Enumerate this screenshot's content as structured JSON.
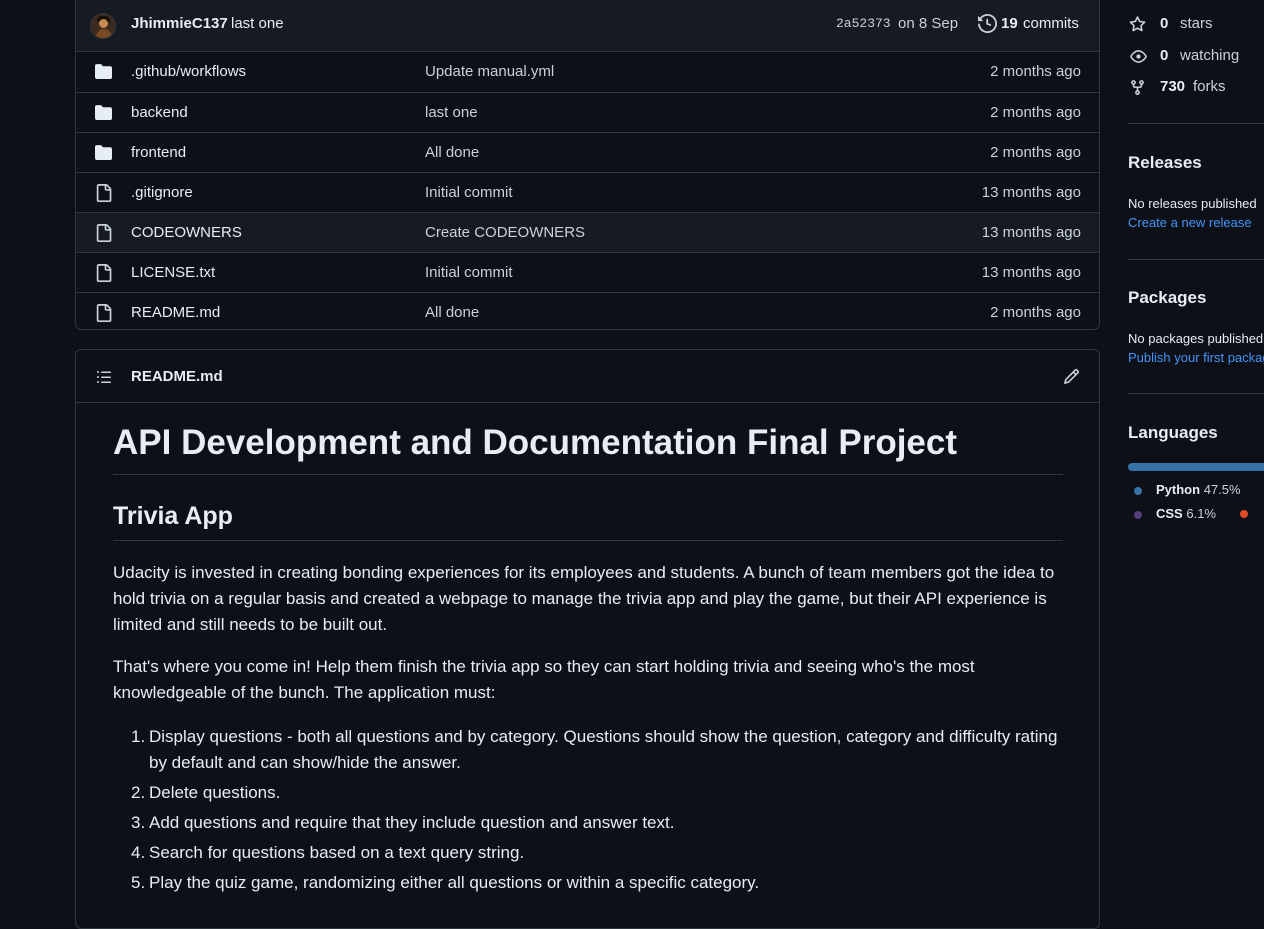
{
  "commit": {
    "author": "JhimmieC137",
    "message": "last one",
    "hash": "2a52373",
    "date": "on 8 Sep",
    "count": "19",
    "count_label": "commits"
  },
  "files": [
    {
      "type": "folder",
      "name": ".github/workflows",
      "message": "Update manual.yml",
      "age": "2 months ago"
    },
    {
      "type": "folder",
      "name": "backend",
      "message": "last one",
      "age": "2 months ago"
    },
    {
      "type": "folder",
      "name": "frontend",
      "message": "All done",
      "age": "2 months ago"
    },
    {
      "type": "file",
      "name": ".gitignore",
      "message": "Initial commit",
      "age": "13 months ago"
    },
    {
      "type": "file",
      "name": "CODEOWNERS",
      "message": "Create CODEOWNERS",
      "age": "13 months ago"
    },
    {
      "type": "file",
      "name": "LICENSE.txt",
      "message": "Initial commit",
      "age": "13 months ago"
    },
    {
      "type": "file",
      "name": "README.md",
      "message": "All done",
      "age": "2 months ago"
    }
  ],
  "readme": {
    "filename": "README.md",
    "h1": "API Development and Documentation Final Project",
    "h2": "Trivia App",
    "p1": "Udacity is invested in creating bonding experiences for its employees and students. A bunch of team members got the idea to hold trivia on a regular basis and created a webpage to manage the trivia app and play the game, but their API experience is limited and still needs to be built out.",
    "p2": "That's where you come in! Help them finish the trivia app so they can start holding trivia and seeing who's the most knowledgeable of the bunch. The application must:",
    "list": [
      "Display questions - both all questions and by category. Questions should show the question, category and difficulty rating by default and can show/hide the answer.",
      "Delete questions.",
      "Add questions and require that they include question and answer text.",
      "Search for questions based on a text query string.",
      "Play the quiz game, randomizing either all questions or within a specific category."
    ]
  },
  "sidebar": {
    "stars_num": "0",
    "stars_label": "stars",
    "watching_num": "0",
    "watching_label": "watching",
    "forks_num": "730",
    "forks_label": "forks",
    "releases_title": "Releases",
    "releases_text": "No releases published",
    "releases_link": "Create a new release",
    "packages_title": "Packages",
    "packages_text": "No packages published",
    "packages_link": "Publish your first package",
    "languages_title": "Languages",
    "languages": [
      {
        "name": "Python",
        "pct": "47.5%",
        "color": "#3572A5"
      },
      {
        "name": "CSS",
        "pct": "6.1%",
        "color": "#563d7c"
      }
    ],
    "third_lang_color": "#e34c26"
  }
}
